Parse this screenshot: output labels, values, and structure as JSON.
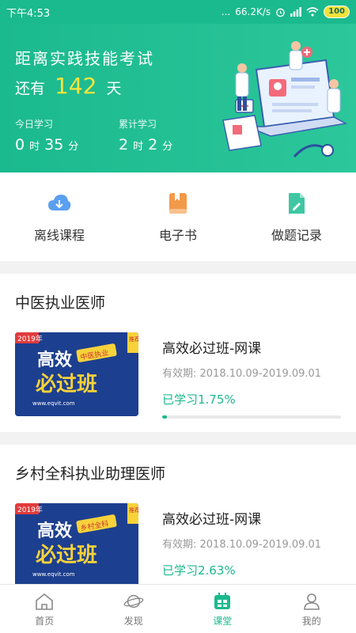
{
  "status_bar": {
    "time": "下午4:53",
    "dots": "...",
    "network_speed": "66.2K/s",
    "battery": "100"
  },
  "hero": {
    "title": "距离实践技能考试",
    "remaining_prefix": "还有",
    "days": "142",
    "days_unit": "天",
    "today_label": "今日学习",
    "today_hours": "0",
    "today_minutes": "35",
    "total_label": "累计学习",
    "total_hours": "2",
    "total_minutes": "2",
    "hour_unit": "时",
    "minute_unit": "分"
  },
  "quick_actions": [
    {
      "label": "离线课程",
      "icon": "cloud-download-icon",
      "color": "#5b9ff0"
    },
    {
      "label": "电子书",
      "icon": "book-icon",
      "color": "#f29a4a"
    },
    {
      "label": "做题记录",
      "icon": "exam-record-icon",
      "color": "#3fc7a3"
    }
  ],
  "sections": [
    {
      "title": "中医执业医师",
      "course": {
        "cover": {
          "year": "2019年",
          "badge": "推荐",
          "line1": "高效",
          "line2": "必过班",
          "tag": "中医执业",
          "url": "www.eqvit.com"
        },
        "name": "高效必过班-网课",
        "validity": "有效期: 2018.10.09-2019.09.01",
        "progress_text": "已学习1.75%",
        "progress": 1.75
      }
    },
    {
      "title": "乡村全科执业助理医师",
      "course": {
        "cover": {
          "year": "2019年",
          "badge": "推荐",
          "line1": "高效",
          "line2": "必过班",
          "tag": "乡村全科",
          "url": "www.eqvit.com"
        },
        "name": "高效必过班-网课",
        "validity": "有效期: 2018.10.09-2019.09.01",
        "progress_text": "已学习2.63%",
        "progress": 2.63
      }
    }
  ],
  "tabbar": [
    {
      "label": "首页",
      "icon": "home-icon",
      "active": false
    },
    {
      "label": "发现",
      "icon": "planet-icon",
      "active": false
    },
    {
      "label": "课堂",
      "icon": "classroom-icon",
      "active": true
    },
    {
      "label": "我的",
      "icon": "profile-icon",
      "active": false
    }
  ],
  "colors": {
    "brand": "#1bb98e",
    "accent_yellow": "#f9e43a"
  }
}
